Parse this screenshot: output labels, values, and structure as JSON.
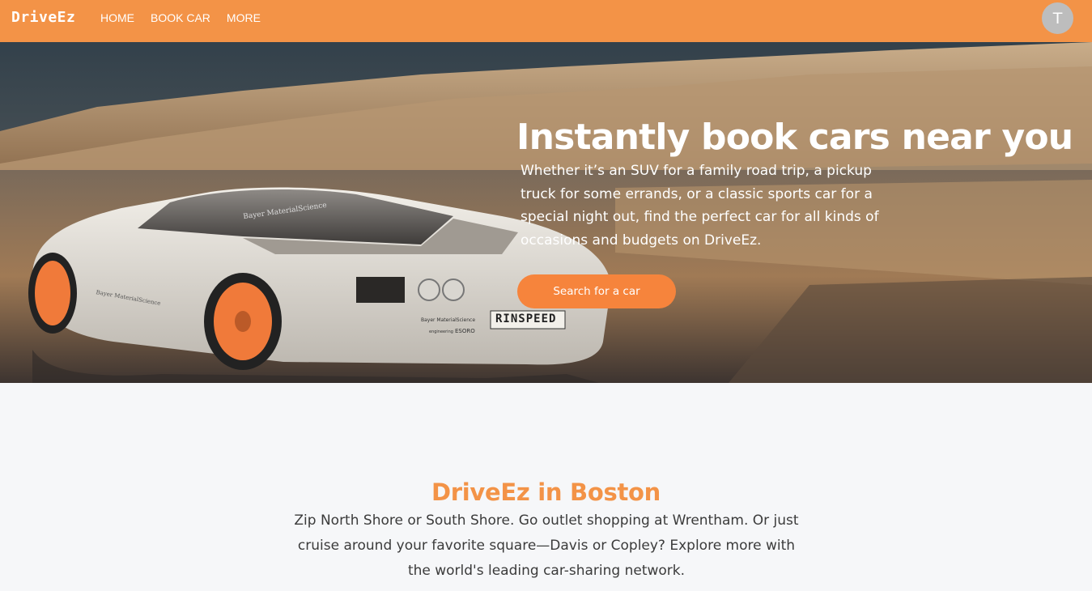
{
  "navbar": {
    "brand": "DriveEz",
    "links": [
      {
        "label": "HOME"
      },
      {
        "label": "BOOK CAR"
      },
      {
        "label": "MORE"
      }
    ],
    "avatar_initial": "T"
  },
  "hero": {
    "title": "Instantly book cars near you",
    "description": "Whether it’s an SUV for a family road trip, a pickup truck for some errands, or a classic sports car for a special night out, find the perfect car for all kinds of occasions and budgets on DriveEz.",
    "cta_label": "Search for a car",
    "image_text": {
      "plate": "RINSPEED",
      "door_logo": "Bayer MaterialScience",
      "side_logo": "Bayer MaterialScience",
      "rear_logo": "Bayer MaterialScience",
      "rear_brand": "ESORO",
      "rear_small": "engineering"
    }
  },
  "section": {
    "title": "DriveEz in Boston",
    "description": "Zip North Shore or South Shore. Go outlet shopping at Wrentham. Or just cruise around your favorite square—Davis or Copley? Explore more with the world's leading car-sharing network."
  },
  "colors": {
    "accent": "#f39347",
    "cta": "#f6843c",
    "background": "#f6f7f9",
    "avatar": "#bdbdbd"
  },
  "icons": {
    "avatar": "user-avatar-icon"
  }
}
